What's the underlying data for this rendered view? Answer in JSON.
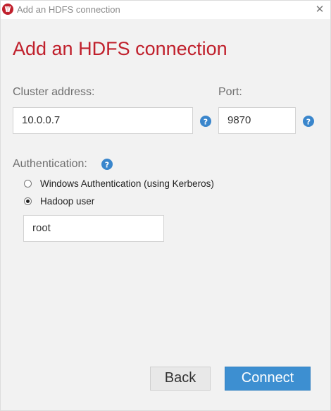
{
  "window": {
    "title": "Add an HDFS connection",
    "close_glyph": "✕"
  },
  "heading": "Add an HDFS connection",
  "cluster": {
    "label": "Cluster address:",
    "value": "10.0.0.7"
  },
  "port": {
    "label": "Port:",
    "value": "9870"
  },
  "authentication": {
    "label": "Authentication:",
    "options": [
      {
        "label": "Windows Authentication (using Kerberos)",
        "selected": false
      },
      {
        "label": "Hadoop user",
        "selected": true
      }
    ],
    "hadoop_user_value": "root"
  },
  "buttons": {
    "back": "Back",
    "connect": "Connect"
  },
  "colors": {
    "accent_red": "#c0202c",
    "primary_blue": "#3d8fd1",
    "help_blue": "#3a86cc"
  },
  "icons": {
    "app": "app-logo-icon",
    "help": "help-icon",
    "close": "close-icon"
  }
}
